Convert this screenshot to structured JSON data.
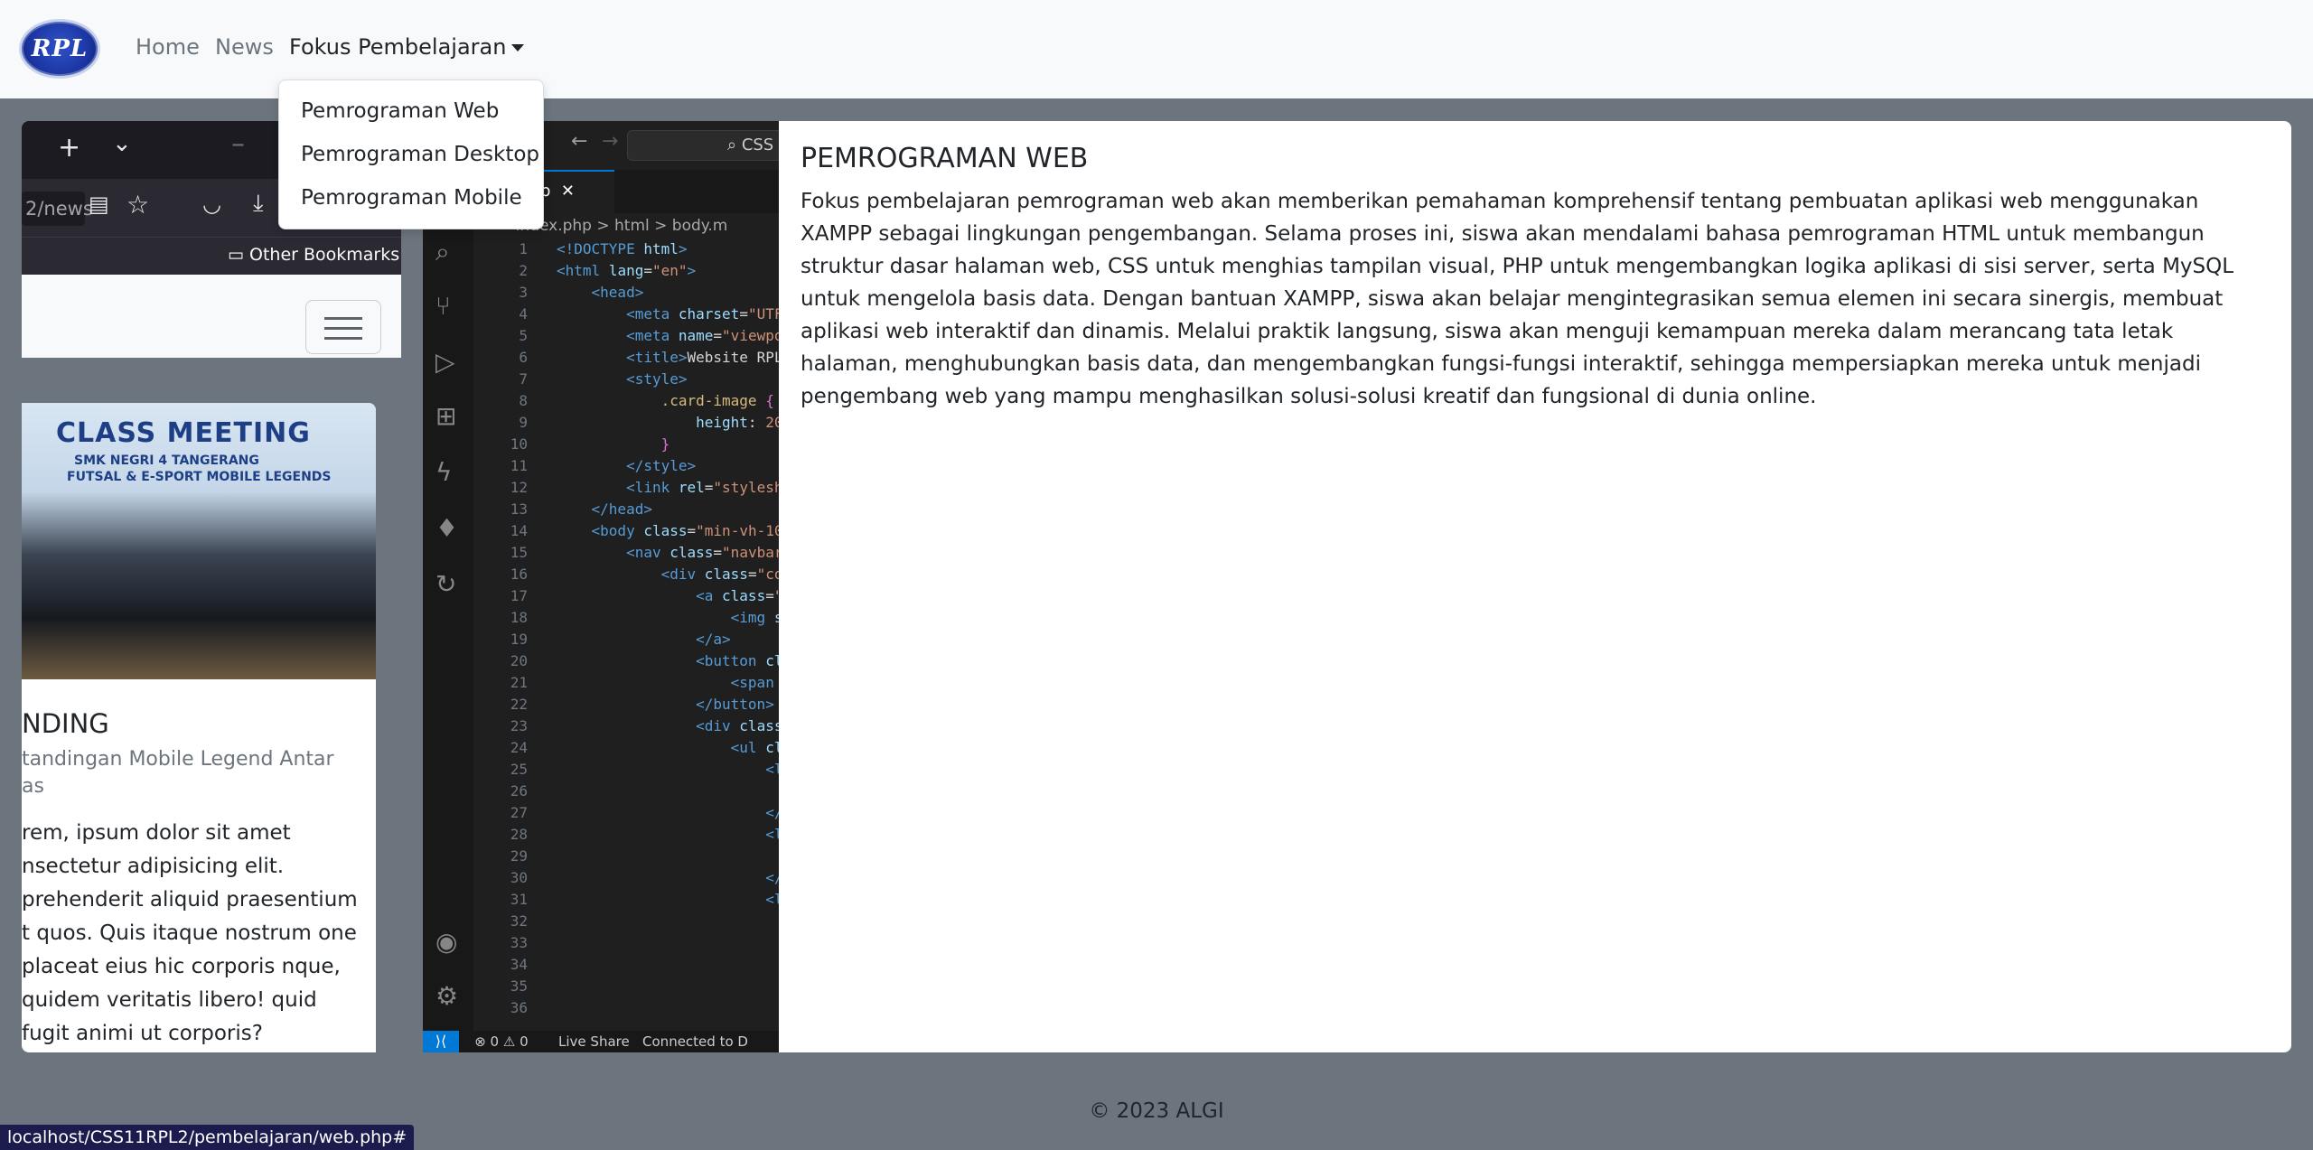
{
  "navbar": {
    "logo_text": "RPL",
    "links": [
      {
        "label": "Home"
      },
      {
        "label": "News"
      },
      {
        "label": "Fokus Pembelajaran"
      }
    ]
  },
  "dropdown": {
    "items": [
      "Pemrograman Web",
      "Pemrograman Desktop",
      "Pemrograman Mobile"
    ]
  },
  "screenshot": {
    "browser": {
      "url_partial": "2/news",
      "bookmark": "Other Bookmarks",
      "photo_title": "CLASS MEETING",
      "photo_sub": "SMK NEGRI 4 TANGERANG",
      "photo_sub2": "FUTSAL & E-SPORT MOBILE LEGENDS",
      "card_title": "NDING",
      "card_subtitle": "tandingan Mobile Legend Antar as",
      "card_text": "rem, ipsum dolor sit amet nsectetur adipisicing elit. prehenderit aliquid praesentium t quos. Quis itaque nostrum one placeat eius hic corporis nque, quidem veritatis libero! quid fugit animi ut corporis?"
    },
    "vscode": {
      "search": "CSS",
      "tab": "p",
      "breadcrumb": "index.php > html > body.m",
      "status_left": "⊗ 0 ⚠ 0",
      "status_live": "Live Share",
      "status_conn": "Connected to D"
    }
  },
  "article": {
    "title": "PEMROGRAMAN WEB",
    "body": "Fokus pembelajaran pemrograman web akan memberikan pemahaman komprehensif tentang pembuatan aplikasi web menggunakan XAMPP sebagai lingkungan pengembangan. Selama proses ini, siswa akan mendalami bahasa pemrograman HTML untuk membangun struktur dasar halaman web, CSS untuk menghias tampilan visual, PHP untuk mengembangkan logika aplikasi di sisi server, serta MySQL untuk mengelola basis data. Dengan bantuan XAMPP, siswa akan belajar mengintegrasikan semua elemen ini secara sinergis, membuat aplikasi web interaktif dan dinamis. Melalui praktik langsung, siswa akan menguji kemampuan mereka dalam merancang tata letak halaman, menghubungkan basis data, dan mengembangkan fungsi-fungsi interaktif, sehingga mempersiapkan mereka untuk menjadi pengembang web yang mampu menghasilkan solusi-solusi kreatif dan fungsional di dunia online."
  },
  "footer": {
    "text": "© 2023 ALGI"
  },
  "status_url": "localhost/CSS11RPL2/pembelajaran/web.php#"
}
